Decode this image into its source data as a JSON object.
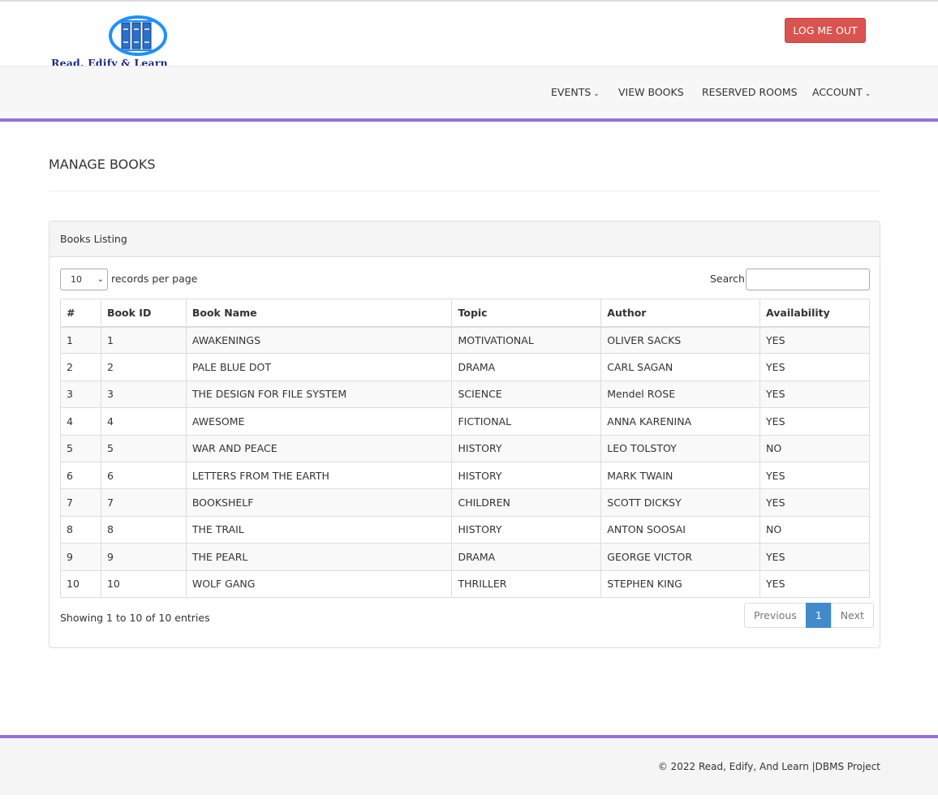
{
  "header": {
    "logo_text": "Read, Edify & Learn",
    "logout_label": "LOG ME OUT"
  },
  "nav": {
    "items": [
      {
        "label": "EVENTS",
        "dropdown": true
      },
      {
        "label": "VIEW BOOKS",
        "dropdown": false
      },
      {
        "label": "RESERVED ROOMS",
        "dropdown": false
      },
      {
        "label": "ACCOUNT",
        "dropdown": true
      }
    ]
  },
  "page": {
    "title": "MANAGE BOOKS"
  },
  "panel": {
    "title": "Books Listing",
    "length_value": "10",
    "length_label": "records per page",
    "search_label": "Search:",
    "search_value": ""
  },
  "table": {
    "columns": [
      "#",
      "Book ID",
      "Book Name",
      "Topic",
      "Author",
      "Availability"
    ],
    "rows": [
      [
        "1",
        "1",
        "AWAKENINGS",
        "MOTIVATIONAL",
        "OLIVER SACKS",
        "YES"
      ],
      [
        "2",
        "2",
        "PALE BLUE DOT",
        "DRAMA",
        "CARL SAGAN",
        "YES"
      ],
      [
        "3",
        "3",
        "THE DESIGN FOR FILE SYSTEM",
        "SCIENCE",
        "Mendel ROSE",
        "YES"
      ],
      [
        "4",
        "4",
        "AWESOME",
        "FICTIONAL",
        "ANNA KARENINA",
        "YES"
      ],
      [
        "5",
        "5",
        "WAR AND PEACE",
        "HISTORY",
        "LEO TOLSTOY",
        "NO"
      ],
      [
        "6",
        "6",
        "LETTERS FROM THE EARTH",
        "HISTORY",
        "MARK TWAIN",
        "YES"
      ],
      [
        "7",
        "7",
        "BOOKSHELF",
        "CHILDREN",
        "SCOTT DICKSY",
        "YES"
      ],
      [
        "8",
        "8",
        "THE TRAIL",
        "HISTORY",
        "ANTON SOOSAI",
        "NO"
      ],
      [
        "9",
        "9",
        "THE PEARL",
        "DRAMA",
        "GEORGE VICTOR",
        "YES"
      ],
      [
        "10",
        "10",
        "WOLF GANG",
        "THRILLER",
        "STEPHEN KING",
        "YES"
      ]
    ]
  },
  "pagination": {
    "info": "Showing 1 to 10 of 10 entries",
    "previous": "Previous",
    "current": "1",
    "next": "Next"
  },
  "footer": {
    "text": "© 2022 Read, Edify, And Learn |DBMS Project"
  },
  "colors": {
    "accent": "#9370db",
    "danger": "#d9534f",
    "primary": "#428bca",
    "logo_blue": "#1e90ff"
  }
}
